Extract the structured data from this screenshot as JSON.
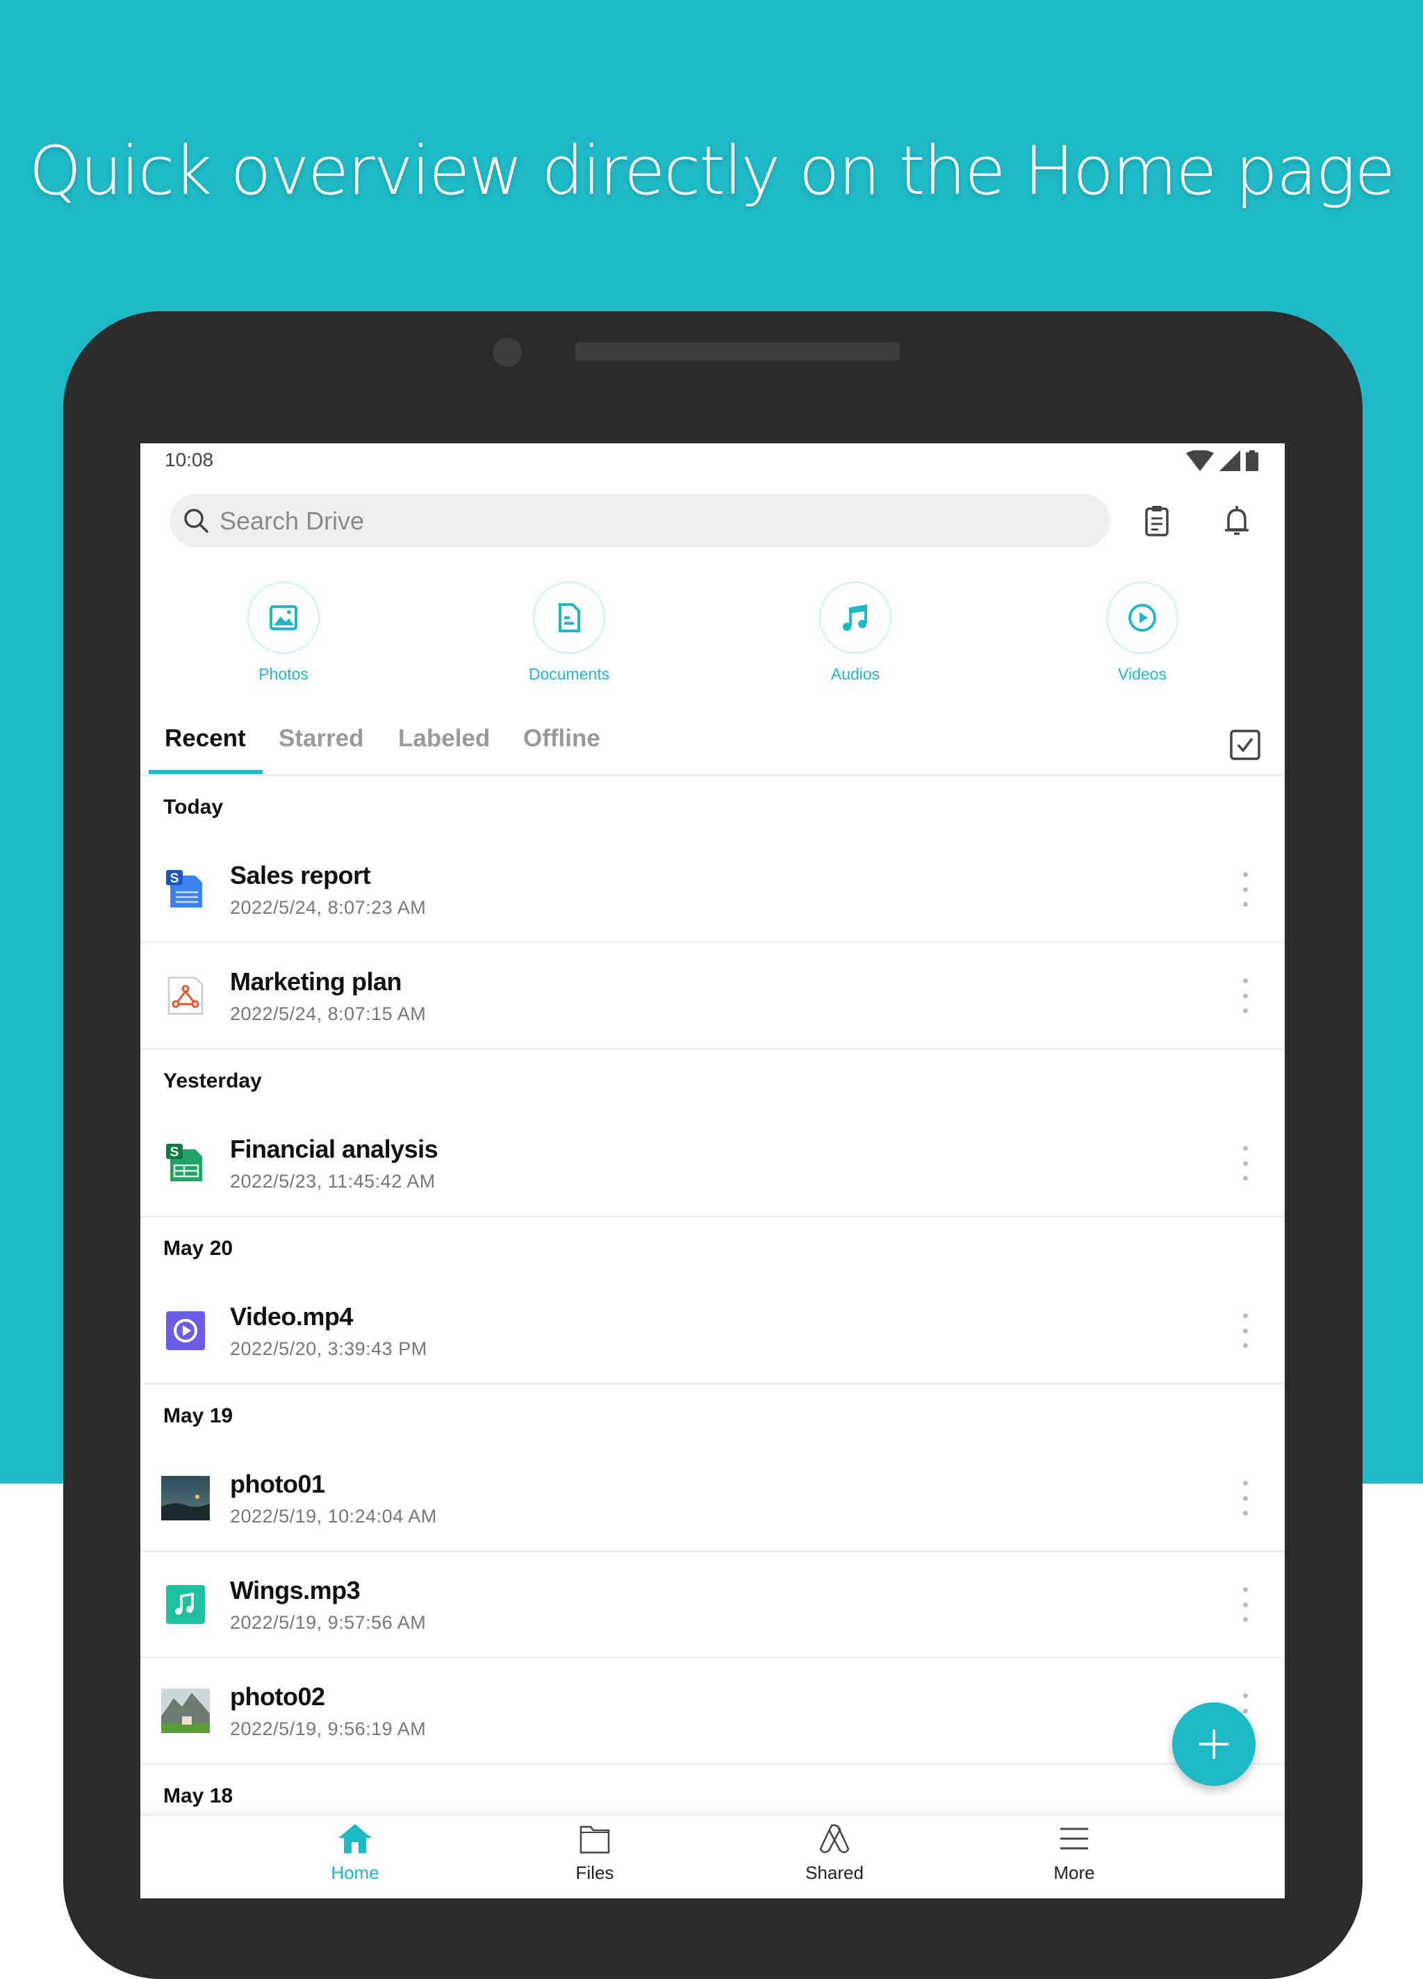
{
  "headline": "Quick overview directly on the Home page",
  "colors": {
    "accent": "#1fb8c5",
    "background": "#1fb8c5",
    "device": "#2b2b2b"
  },
  "status": {
    "time": "10:08",
    "icons": [
      "wifi-icon",
      "signal-icon",
      "battery-icon"
    ]
  },
  "search": {
    "placeholder": "Search Drive"
  },
  "categories": [
    {
      "label": "Photos",
      "icon": "image-icon"
    },
    {
      "label": "Documents",
      "icon": "document-icon"
    },
    {
      "label": "Audios",
      "icon": "music-icon"
    },
    {
      "label": "Videos",
      "icon": "play-icon"
    }
  ],
  "tabs": [
    {
      "label": "Recent",
      "active": true
    },
    {
      "label": "Starred"
    },
    {
      "label": "Labeled"
    },
    {
      "label": "Offline"
    }
  ],
  "groups": [
    {
      "header": "Today",
      "items": [
        {
          "name": "Sales report",
          "date": "2022/5/24, 8:07:23 AM",
          "type": "doc"
        },
        {
          "name": "Marketing plan",
          "date": "2022/5/24, 8:07:15 AM",
          "type": "pdf"
        }
      ]
    },
    {
      "header": "Yesterday",
      "items": [
        {
          "name": "Financial analysis",
          "date": "2022/5/23, 11:45:42 AM",
          "type": "sheet"
        }
      ]
    },
    {
      "header": "May 20",
      "items": [
        {
          "name": "Video.mp4",
          "date": "2022/5/20, 3:39:43 PM",
          "type": "video"
        }
      ]
    },
    {
      "header": "May 19",
      "items": [
        {
          "name": "photo01",
          "date": "2022/5/19, 10:24:04 AM",
          "type": "photo1"
        },
        {
          "name": "Wings.mp3",
          "date": "2022/5/19, 9:57:56 AM",
          "type": "audio"
        },
        {
          "name": "photo02",
          "date": "2022/5/19, 9:56:19 AM",
          "type": "photo2"
        }
      ]
    },
    {
      "header": "May 18",
      "items": []
    }
  ],
  "nav": [
    {
      "label": "Home",
      "active": true
    },
    {
      "label": "Files"
    },
    {
      "label": "Shared"
    },
    {
      "label": "More"
    }
  ]
}
